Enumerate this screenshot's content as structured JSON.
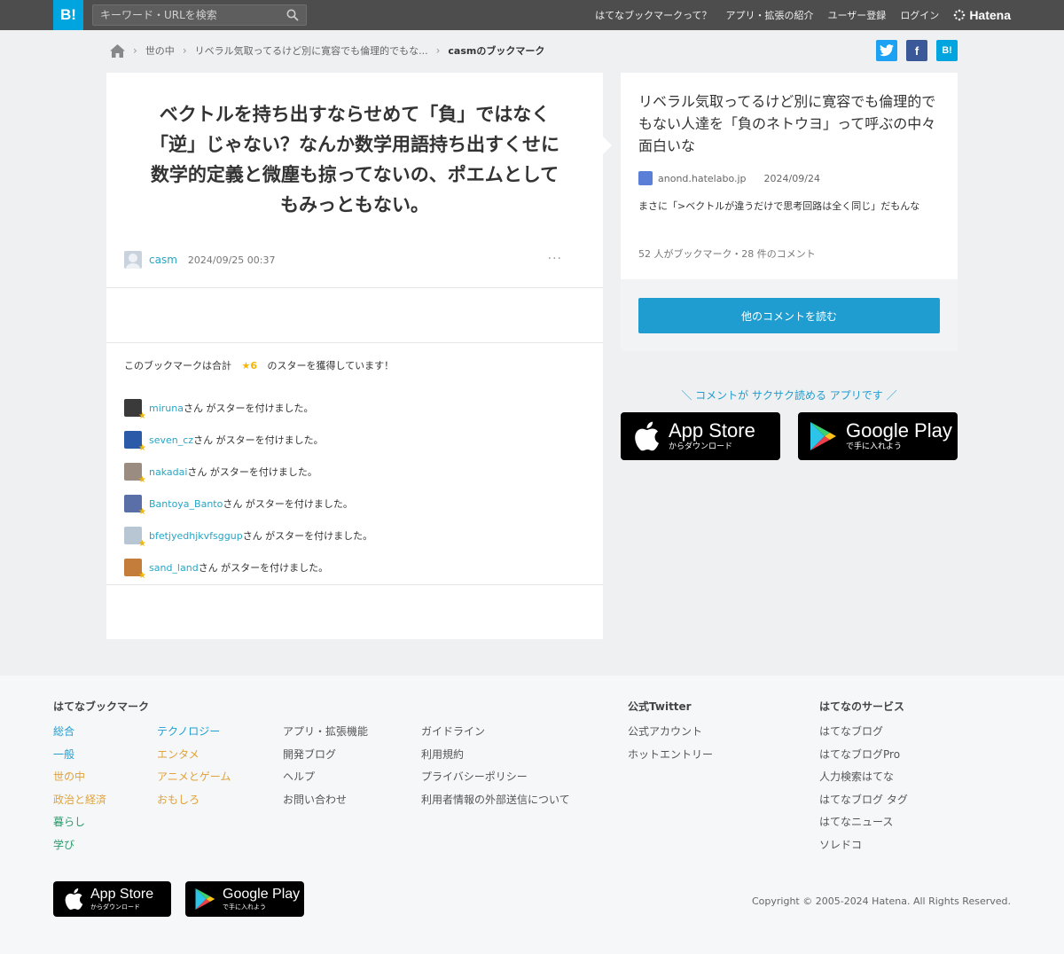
{
  "header": {
    "logo": "B!",
    "search_placeholder": "キーワード・URLを検索",
    "nav": [
      "はてなブックマークって？",
      "アプリ・拡張の紹介",
      "ユーザー登録",
      "ログイン"
    ],
    "brand": "Hatena"
  },
  "breadcrumb": {
    "items": [
      "世の中",
      "リベラル気取ってるけど別に寛容でも倫理的でもな...",
      "casmのブックマーク"
    ]
  },
  "share": {
    "twitter": "t",
    "facebook": "f",
    "hatena": "B!"
  },
  "bookmark": {
    "comment_lines": [
      "ベクトルを持ち出すならせめて「負」ではなく",
      "「逆」じゃない？なんか数学用語持ち出すくせに",
      "数学的定義と微塵も掠ってないの、ポエムとして",
      "もみっともない。"
    ],
    "user": "casm",
    "datetime": "2024/09/25 00:37",
    "more": "···"
  },
  "stars": {
    "summary_prefix": "このブックマークは合計",
    "count": "★6",
    "summary_suffix": "のスターを獲得しています！",
    "suffix": "さん がスターを付けました。",
    "users": [
      {
        "name": "miruna",
        "avatar_color": "#3a3a3a"
      },
      {
        "name": "seven_cz",
        "avatar_color": "#2b5aa8"
      },
      {
        "name": "nakadai",
        "avatar_color": "#9a8c80"
      },
      {
        "name": "Bantoya_Banto",
        "avatar_color": "#5a6fa8"
      },
      {
        "name": "bfetjyedhjkvfsggup",
        "avatar_color": "#b8c6d3"
      },
      {
        "name": "sand_land",
        "avatar_color": "#c47d3a"
      }
    ]
  },
  "entry": {
    "title": "リベラル気取ってるけど別に寛容でも倫理的でもない人達を「負のネトウヨ」って呼ぶの中々面白いな",
    "domain": "anond.hatelabo.jp",
    "date": "2024/09/24",
    "description": "まさに「>ベクトルが違うだけで思考回路は全く同じ」だもんな",
    "count": "52 人がブックマーク・28 件のコメント",
    "read_more": "他のコメントを読む"
  },
  "app": {
    "promo": "＼ コメントが サクサク読める アプリです ／",
    "appstore_title": "App Store",
    "appstore_sub": "からダウンロード",
    "googleplay_title": "Google Play",
    "googleplay_sub": "で手に入れよう"
  },
  "footer": {
    "heading_bookmark": "はてなブックマーク",
    "categories_1": [
      {
        "label": "総合",
        "color": "#1f9dd0"
      },
      {
        "label": "一般",
        "color": "#1f9dd0"
      },
      {
        "label": "世の中",
        "color": "#e0a23a"
      },
      {
        "label": "政治と経済",
        "color": "#e0a23a"
      },
      {
        "label": "暮らし",
        "color": "#2a9a6a"
      },
      {
        "label": "学び",
        "color": "#2a9a6a"
      }
    ],
    "categories_2": [
      {
        "label": "テクノロジー",
        "color": "#1f9dd0"
      },
      {
        "label": "エンタメ",
        "color": "#e0a23a"
      },
      {
        "label": "アニメとゲーム",
        "color": "#e0a23a"
      },
      {
        "label": "おもしろ",
        "color": "#e0a23a"
      }
    ],
    "links_3": [
      "アプリ・拡張機能",
      "開発ブログ",
      "ヘルプ",
      "お問い合わせ"
    ],
    "links_4": [
      "ガイドライン",
      "利用規約",
      "プライバシーポリシー",
      "利用者情報の外部送信について"
    ],
    "heading_twitter": "公式Twitter",
    "twitter_links": [
      "公式アカウント",
      "ホットエントリー"
    ],
    "heading_services": "はてなのサービス",
    "services": [
      "はてなブログ",
      "はてなブログPro",
      "人力検索はてな",
      "はてなブログ タグ",
      "はてなニュース",
      "ソレドコ"
    ],
    "copyright": "Copyright © 2005-2024 Hatena. All Rights Reserved."
  }
}
